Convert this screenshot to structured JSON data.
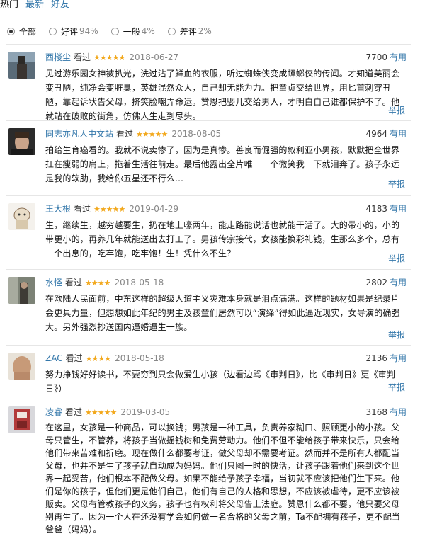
{
  "tabs": {
    "hot": "热门",
    "latest": "最新",
    "friends": "好友"
  },
  "filters": {
    "all": "全部",
    "good": "好评",
    "good_pct": "94%",
    "mid": "一般",
    "mid_pct": "4%",
    "bad": "差评",
    "bad_pct": "2%"
  },
  "star_color": "#f2a81c",
  "link_color": "#3377aa",
  "report_label": "举报",
  "useful_label": "有用",
  "reviews": [
    {
      "user": "西楼尘",
      "watched": "看过",
      "stars": "★★★★★",
      "date": "2018-06-27",
      "votes": "7700",
      "text": "见过游乐园女神被扒光，洗过沾了鲜血的衣服，听过蜘蛛侠变成蟑螂侠的传闻。才知道美丽会变丑陋，纯净会变脏臭，英雄混然众人，自己却无能为力。把童贞交给世界，用匕首刺穿丑陋，靠起诉状告父母，挤笑脸嘲弄命运。赞恩把婴儿交给男人，才明白自己谁都保护不了。他就站在破败的街角，仿佛人生走到尽头。"
    },
    {
      "user": "同志亦凡人中文站",
      "watched": "看过",
      "stars": "★★★★★",
      "date": "2018-08-05",
      "votes": "4964",
      "text": "拍给生育癌看的。我就不说卖惨了，因为是真惨。善良而倔强的叙利亚小男孩，默默把全世界扛在瘦弱的肩上，拖着生活往前走。最后他露出全片唯一一个微笑我一下就泪奔了。孩子永远是我的软肋，我给你五星还不行么…"
    },
    {
      "user": "王大根",
      "watched": "看过",
      "stars": "★★★★★",
      "date": "2019-04-29",
      "votes": "4183",
      "text": "生，继续生，越穷越要生，扔在地上嚎两年，能走路能说话也就能干活了。大的带小的，小的带更小的，再养几年就能送出去打工了。男孩传宗接代，女孩能换彩礼钱，生那么多个，总有一个出息的，吃牢饱，吃牢饱！生！凭什么不生？"
    },
    {
      "user": "水怪",
      "watched": "看过",
      "stars": "★★★★",
      "date": "2018-05-18",
      "votes": "2802",
      "text": "在欧陆人民面前，中东这样的超级人道主义灾难本身就是泪点满满。这样的题材如果是纪录片会更具力量，但想想如此年纪的男主及孩童们居然可以“演绎”得如此逼近现实，女导演的确强大。另外强烈抄送国内逼婚逼生一族。"
    },
    {
      "user": "ZAC",
      "watched": "看过",
      "stars": "★★★★",
      "date": "2018-05-18",
      "votes": "2136",
      "text": "努力挣钱好好读书，不要穷到只会做爱生小孩（边看边骂《审判日》，比《审判日》更《审判日》）"
    },
    {
      "user": "凌睿",
      "watched": "看过",
      "stars": "★★★★★",
      "date": "2019-03-05",
      "votes": "3168",
      "text": "在这里，女孩是一种商品，可以换钱；男孩是一种工具，负责养家糊口、照顾更小的小孩。父母只管生，不管养，将孩子当做摇钱树和免费劳动力。他们不但不能给孩子带来快乐，只会给他们带来苦难和折磨。现在做什么都要考证，做父母却不需要考证。然而并不是所有人都配当父母，也并不是生了孩子就自动成为妈妈。他们只图一时的快活，让孩子跟着他们来到这个世界一起受苦，他们根本不配做父母。如果不能给予孩子幸福，当初就不应该把他们生下来。他们是你的孩子，但他们更是他们自己，他们有自己的人格和思想，不应该被虐待，更不应该被贩卖。父母有管教孩子的义务，孩子也有权利将父母告上法庭。赞恩什么都不要，他只要父母别再生了。因为一个人在还没有学会如何做一名合格的父母之前，Ta不配拥有孩子，更不配当爸爸（妈妈）。"
    }
  ]
}
